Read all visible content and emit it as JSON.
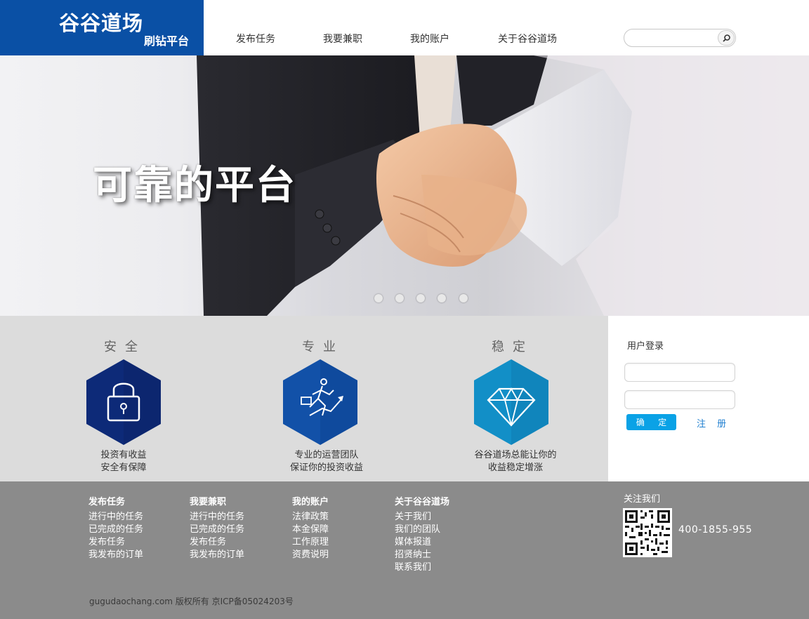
{
  "header": {
    "logo_main": "谷谷道场",
    "logo_sub": "刷钻平台",
    "nav": [
      "发布任务",
      "我要兼职",
      "我的账户",
      "关于谷谷道场"
    ],
    "search_placeholder": ""
  },
  "banner": {
    "slogan": "可靠的平台",
    "slide_count": 5
  },
  "features": [
    {
      "title": "安全",
      "icon": "lock-icon",
      "desc": [
        "投资有收益",
        "安全有保障"
      ],
      "color": "#0d2a78"
    },
    {
      "title": "专业",
      "icon": "runner-chart-icon",
      "desc": [
        "专业的运营团队",
        "保证你的投资收益"
      ],
      "color": "#1251a8"
    },
    {
      "title": "稳定",
      "icon": "diamond-icon",
      "desc": [
        "谷谷道场总能让你的",
        "收益稳定增涨"
      ],
      "color": "#128fc7"
    }
  ],
  "login": {
    "title": "用户登录",
    "username_value": "",
    "password_value": "",
    "submit_label": "确 定",
    "register_label": "注 册"
  },
  "footer": {
    "columns": [
      {
        "title": "发布任务",
        "links": [
          "进行中的任务",
          "已完成的任务",
          "发布任务",
          "我发布的订单"
        ]
      },
      {
        "title": "我要兼职",
        "links": [
          "进行中的任务",
          "已完成的任务",
          "发布任务",
          "我发布的订单"
        ]
      },
      {
        "title": "我的账户",
        "links": [
          "法律政策",
          "本金保障",
          "工作原理",
          "资费说明"
        ]
      },
      {
        "title": "关于谷谷道场",
        "links": [
          "关于我们",
          "我们的团队",
          "媒体报道",
          "招贤纳士",
          "联系我们"
        ]
      }
    ],
    "follow_label": "关注我们",
    "phone": "400-1855-955",
    "copyright": "gugudaochang.com 版权所有 京ICP备05024203号"
  }
}
